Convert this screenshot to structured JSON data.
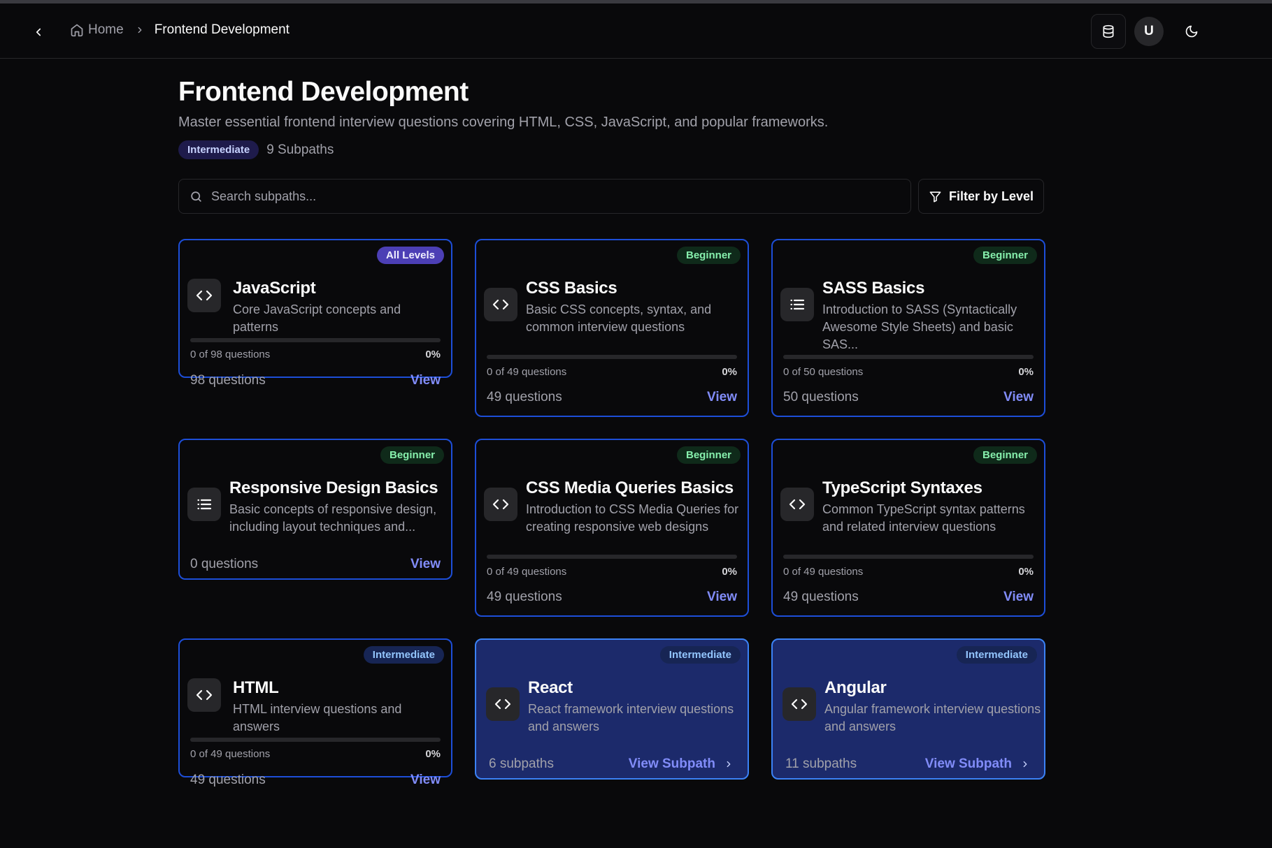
{
  "header": {
    "breadcrumb_home": "Home",
    "breadcrumb_current": "Frontend Development",
    "avatar_initial": "U"
  },
  "page": {
    "title": "Frontend Development",
    "description": "Master essential frontend interview questions covering HTML, CSS, JavaScript, and popular frameworks.",
    "level": "Intermediate",
    "subpath_count": "9 Subpaths"
  },
  "search": {
    "placeholder": "Search subpaths...",
    "value": ""
  },
  "filter": {
    "label": "Filter by Level"
  },
  "colors": {
    "background": "#09090b",
    "card_border": "#1d4ed8",
    "active_card_bg": "#1c2a6b",
    "accent_link": "#818cf8"
  },
  "cards": [
    {
      "title": "JavaScript",
      "description": "Core JavaScript concepts and patterns",
      "level": "All Levels",
      "icon": "code-icon",
      "progress_text": "0 of 98 questions",
      "progress_pct": "0%",
      "progress_value": 0,
      "count": "98 questions",
      "link": "View"
    },
    {
      "title": "CSS Basics",
      "description": "Basic CSS concepts, syntax, and common interview questions",
      "level": "Beginner",
      "icon": "code-icon",
      "progress_text": "0 of 49 questions",
      "progress_pct": "0%",
      "progress_value": 0,
      "count": "49 questions",
      "link": "View"
    },
    {
      "title": "SASS Basics",
      "description": "Introduction to SASS (Syntactically Awesome Style Sheets) and basic SAS...",
      "level": "Beginner",
      "icon": "list-icon",
      "progress_text": "0 of 50 questions",
      "progress_pct": "0%",
      "progress_value": 0,
      "count": "50 questions",
      "link": "View"
    },
    {
      "title": "Responsive Design Basics",
      "description": "Basic concepts of responsive design, including layout techniques and...",
      "level": "Beginner",
      "icon": "list-icon",
      "count": "0 questions",
      "link": "View"
    },
    {
      "title": "CSS Media Queries Basics",
      "description": "Introduction to CSS Media Queries for creating responsive web designs",
      "level": "Beginner",
      "icon": "code-icon",
      "progress_text": "0 of 49 questions",
      "progress_pct": "0%",
      "progress_value": 0,
      "count": "49 questions",
      "link": "View"
    },
    {
      "title": "TypeScript Syntaxes",
      "description": "Common TypeScript syntax patterns and related interview questions",
      "level": "Beginner",
      "icon": "code-icon",
      "progress_text": "0 of 49 questions",
      "progress_pct": "0%",
      "progress_value": 0,
      "count": "49 questions",
      "link": "View"
    },
    {
      "title": "HTML",
      "description": "HTML interview questions and answers",
      "level": "Intermediate",
      "icon": "code-icon",
      "progress_text": "0 of 49 questions",
      "progress_pct": "0%",
      "progress_value": 0,
      "count": "49 questions",
      "link": "View"
    },
    {
      "title": "React",
      "description": "React framework interview questions and answers",
      "level": "Intermediate",
      "icon": "code-icon",
      "count": "6 subpaths",
      "link": "View Subpath"
    },
    {
      "title": "Angular",
      "description": "Angular framework interview questions and answers",
      "level": "Intermediate",
      "icon": "code-icon",
      "count": "11 subpaths",
      "link": "View Subpath"
    }
  ]
}
